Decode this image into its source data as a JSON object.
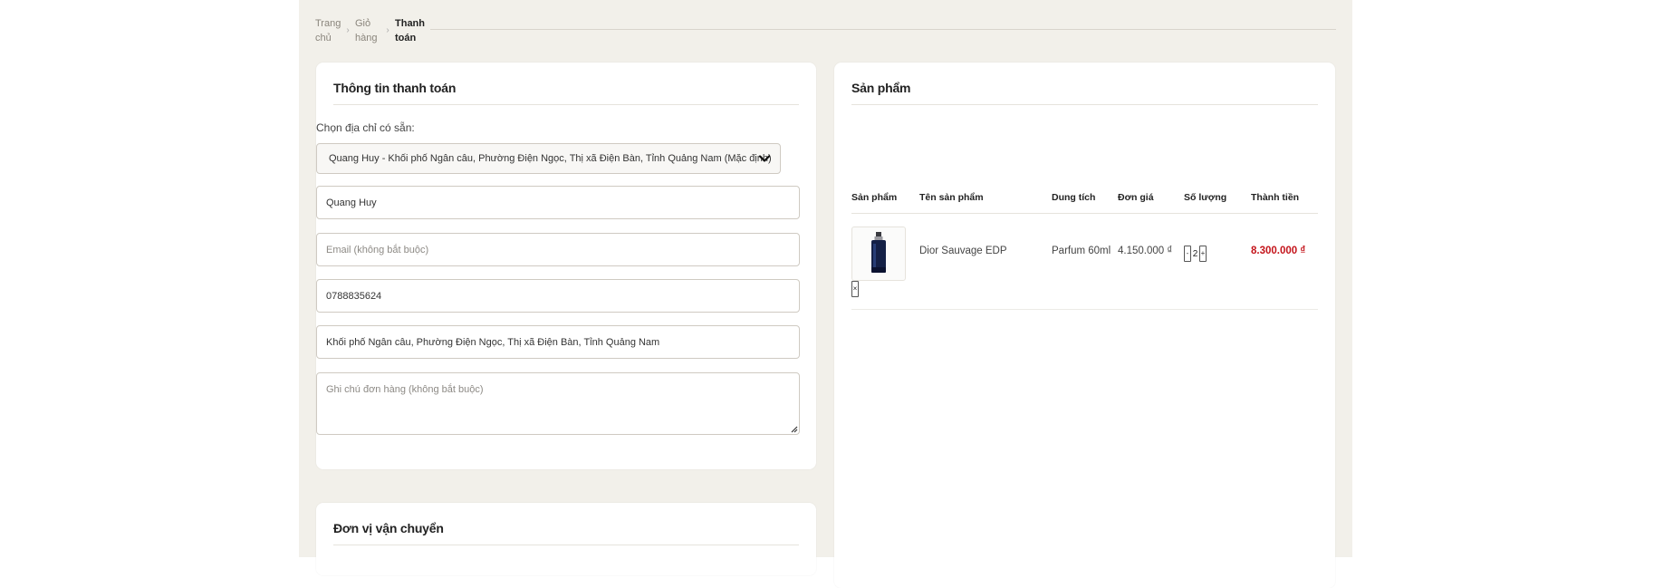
{
  "breadcrumb": {
    "home": "Trang chủ",
    "cart": "Giỏ hàng",
    "current": "Thanh toán"
  },
  "billing": {
    "title": "Thông tin thanh toán",
    "address_label": "Chọn địa chỉ có sẵn:",
    "address_selected": "Quang Huy - Khối phố Ngân câu, Phường Điện Ngọc, Thị xã Điện Bàn, Tỉnh Quảng Nam (Mặc định)",
    "name_value": "Quang Huy",
    "email_placeholder": "Email (không bắt buộc)",
    "phone_value": "0788835624",
    "address_value": "Khối phố Ngân câu, Phường Điện Ngọc, Thị xã Điện Bàn, Tỉnh Quảng Nam",
    "note_placeholder": "Ghi chú đơn hàng (không bắt buộc)"
  },
  "shipping": {
    "title": "Đơn vị vận chuyển"
  },
  "products": {
    "title": "Sản phẩm",
    "columns": [
      "Sản phẩm",
      "Tên sản phẩm",
      "Dung tích",
      "Đơn giá",
      "Số lượng",
      "Thành tiền"
    ],
    "items": [
      {
        "name": "Dior Sauvage EDP",
        "volume": "Parfum 60ml",
        "price": "4.150.000 ₫",
        "quantity": "2",
        "total": "8.300.000 ₫"
      }
    ]
  },
  "colors": {
    "page_bg": "#f2f0ea",
    "total_red": "#c4141b"
  }
}
